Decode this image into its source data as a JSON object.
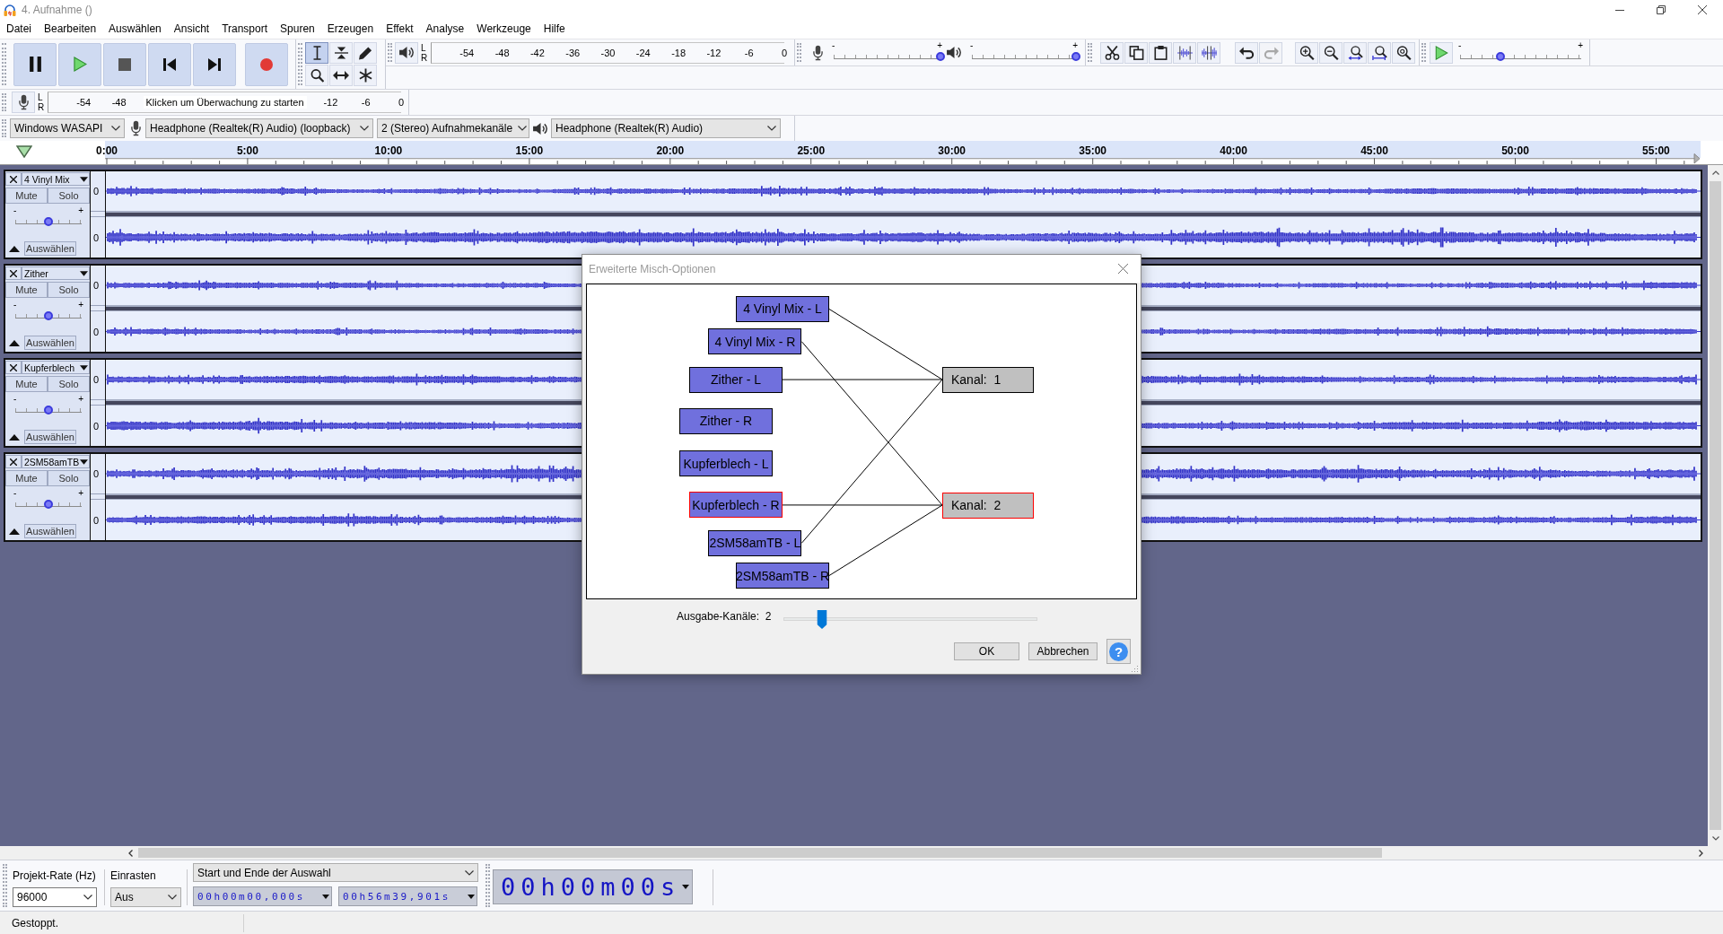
{
  "window": {
    "title": "4. Aufnahme ()"
  },
  "menu": [
    "Datei",
    "Bearbeiten",
    "Auswählen",
    "Ansicht",
    "Transport",
    "Spuren",
    "Erzeugen",
    "Effekt",
    "Analyse",
    "Werkzeuge",
    "Hilfe"
  ],
  "toolbar": {
    "tools": [
      {
        "kind": "select",
        "selected": true
      },
      {
        "kind": "envelope",
        "selected": false
      },
      {
        "kind": "draw",
        "selected": false
      },
      {
        "kind": "zoom",
        "selected": false
      },
      {
        "kind": "time_shift",
        "selected": false
      },
      {
        "kind": "multi",
        "selected": false
      }
    ],
    "playback_meter": {
      "channels": [
        "L",
        "R"
      ],
      "ticks": [
        "-54",
        "-48",
        "-42",
        "-36",
        "-30",
        "-24",
        "-18",
        "-12",
        "-6",
        "0"
      ]
    },
    "recording_volume": {
      "min_label": "-",
      "max_label": "+",
      "level": 1
    },
    "playback_volume": {
      "min_label": "-",
      "max_label": "+",
      "level": 1
    },
    "history": [
      {
        "kind": "undo",
        "disabled": false
      },
      {
        "kind": "redo",
        "disabled": true
      }
    ],
    "play_at_speed": {
      "min_label": "-",
      "max_label": "+",
      "level": 0.33
    },
    "recording_meter": {
      "channels": [
        "L",
        "R"
      ],
      "ticks_before": [
        "-54",
        "-48"
      ],
      "hint": "Klicken um Überwachung zu starten",
      "ticks_after": [
        "-12",
        "-6",
        "0"
      ]
    },
    "devices": {
      "host": "Windows WASAPI",
      "recording_device": "Headphone (Realtek(R) Audio) (loopback)",
      "recording_channels": "2 (Stereo) Aufnahmekanäle",
      "playback_device": "Headphone (Realtek(R) Audio)"
    }
  },
  "ruler": {
    "labels": [
      "0:00",
      "5:00",
      "10:00",
      "15:00",
      "20:00",
      "25:00",
      "30:00",
      "35:00",
      "40:00",
      "45:00",
      "50:00",
      "55:00"
    ]
  },
  "tracks": [
    {
      "name": "4 Vinyl Mix",
      "mute": "Mute",
      "solo": "Solo",
      "select": "Auswählen",
      "gain": {
        "min_label": "-",
        "max_label": "+",
        "level": 0.5
      },
      "channels": [
        {
          "scale_label": "0"
        },
        {
          "scale_label": "0"
        }
      ]
    },
    {
      "name": "Zither",
      "mute": "Mute",
      "solo": "Solo",
      "select": "Auswählen",
      "gain": {
        "min_label": "-",
        "max_label": "+",
        "level": 0.5
      },
      "channels": [
        {
          "scale_label": "0"
        },
        {
          "scale_label": "0"
        }
      ]
    },
    {
      "name": "Kupferblech",
      "mute": "Mute",
      "solo": "Solo",
      "select": "Auswählen",
      "gain": {
        "min_label": "-",
        "max_label": "+",
        "level": 0.5
      },
      "channels": [
        {
          "scale_label": "0"
        },
        {
          "scale_label": "0"
        }
      ]
    },
    {
      "name": "2SM58amTB",
      "mute": "Mute",
      "solo": "Solo",
      "select": "Auswählen",
      "gain": {
        "min_label": "-",
        "max_label": "+",
        "level": 0.5
      },
      "channels": [
        {
          "scale_label": "0"
        },
        {
          "scale_label": "0"
        }
      ]
    }
  ],
  "dialog": {
    "title": "Erweiterte Misch-Optionen",
    "inputs": [
      {
        "label": "4 Vinyl Mix - L",
        "selected": false,
        "routing": [
          true,
          false
        ]
      },
      {
        "label": "4 Vinyl Mix - R",
        "selected": false,
        "routing": [
          false,
          true
        ]
      },
      {
        "label": "Zither - L",
        "selected": false,
        "routing": [
          true,
          false
        ]
      },
      {
        "label": "Zither - R",
        "selected": false,
        "routing": [
          false,
          false
        ]
      },
      {
        "label": "Kupferblech - L",
        "selected": false,
        "routing": [
          false,
          false
        ]
      },
      {
        "label": "Kupferblech - R",
        "selected": true,
        "routing": [
          false,
          true
        ]
      },
      {
        "label": "2SM58amTB - L",
        "selected": false,
        "routing": [
          true,
          false
        ]
      },
      {
        "label": "2SM58amTB - R",
        "selected": false,
        "routing": [
          false,
          true
        ]
      }
    ],
    "outputs": [
      {
        "label": "Kanal:  1",
        "selected": false
      },
      {
        "label": "Kanal:  2",
        "selected": true
      }
    ],
    "output_channels": {
      "label": "Ausgabe-Kanäle:  2",
      "level": 0.15
    },
    "buttons": [
      "OK",
      "Abbrechen"
    ],
    "help": "?"
  },
  "selection_toolbar": {
    "rate_label": "Projekt-Rate (Hz)",
    "rate": "96000",
    "snap_label": "Einrasten",
    "snap": "Aus",
    "mode": "Start und Ende der Auswahl",
    "start": "00h00m00,000s",
    "end": "00h56m39,901s"
  },
  "time_display": "00h00m00s",
  "status_bar": "Gestoppt."
}
